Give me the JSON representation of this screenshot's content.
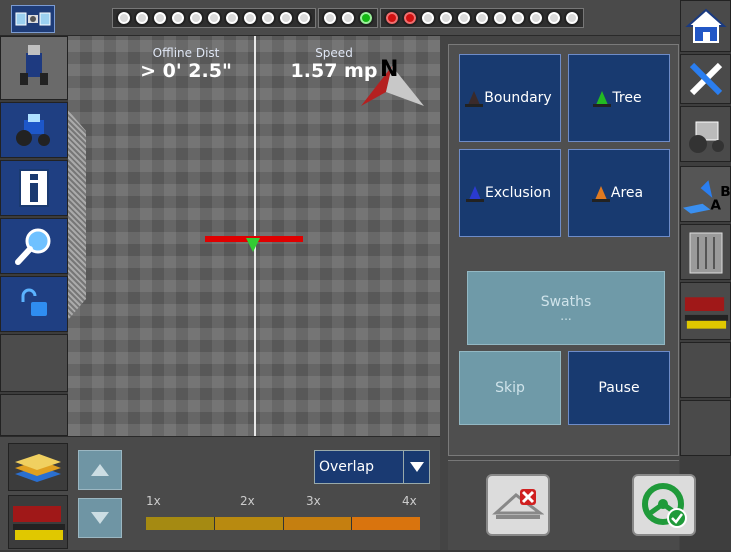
{
  "status": {
    "leds_left": [
      "off",
      "off",
      "off",
      "off",
      "off",
      "off",
      "off",
      "off",
      "off",
      "off",
      "off"
    ],
    "leds_mid": [
      "off",
      "off",
      "green"
    ],
    "leds_right": [
      "red",
      "red",
      "off",
      "off",
      "off",
      "off",
      "off",
      "off",
      "off",
      "off",
      "off"
    ]
  },
  "map": {
    "offline_label": "Offline Dist",
    "offline_value": "> 0' 2.5\"",
    "speed_label": "Speed",
    "speed_value": "1.57 mp",
    "north_label": "N"
  },
  "left_toolbar": {
    "icons": [
      "satellite-icon",
      "implement-icon",
      "tractor-icon",
      "info-icon",
      "zoom-icon",
      "unlock-icon"
    ]
  },
  "panel": {
    "boundary_label": "Boundary",
    "tree_label": "Tree",
    "exclusion_label": "Exclusion",
    "area_label": "Area",
    "swaths_label": "Swaths",
    "swaths_value": "...",
    "skip_label": "Skip",
    "pause_label": "Pause"
  },
  "coverage": {
    "mode": "Overlap",
    "scale_labels": [
      "1x",
      "2x",
      "3x",
      "4x"
    ],
    "scale_colors": [
      "#a58a12",
      "#b88a10",
      "#c57f10",
      "#d9740e"
    ]
  },
  "right_toolbar": {
    "icons": [
      "home-icon",
      "tools-icon",
      "vehicle-settings-icon",
      "ab-line-icon",
      "planter-icon",
      "seeder-icon"
    ]
  }
}
